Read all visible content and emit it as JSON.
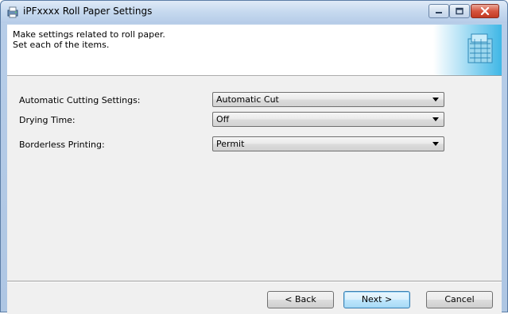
{
  "window": {
    "title": "iPFxxxx Roll Paper Settings"
  },
  "header": {
    "line1": "Make settings related to roll paper.",
    "line2": "Set each of the items."
  },
  "fields": [
    {
      "label": "Automatic Cutting Settings:",
      "value": "Automatic Cut"
    },
    {
      "label": "Drying Time:",
      "value": "Off"
    },
    {
      "label": "Borderless Printing:",
      "value": "Permit"
    }
  ],
  "buttons": {
    "back": "< Back",
    "next": "Next >",
    "cancel": "Cancel"
  },
  "icons": {
    "app": "printer-settings-icon",
    "minimize": "minimize-icon",
    "maximize": "maximize-icon",
    "close": "close-icon",
    "dropdown": "chevron-down-icon"
  },
  "colors": {
    "titlebar": "#c6d9ef",
    "close_button": "#d6553f",
    "dialog_bg": "#f0f0f0"
  }
}
